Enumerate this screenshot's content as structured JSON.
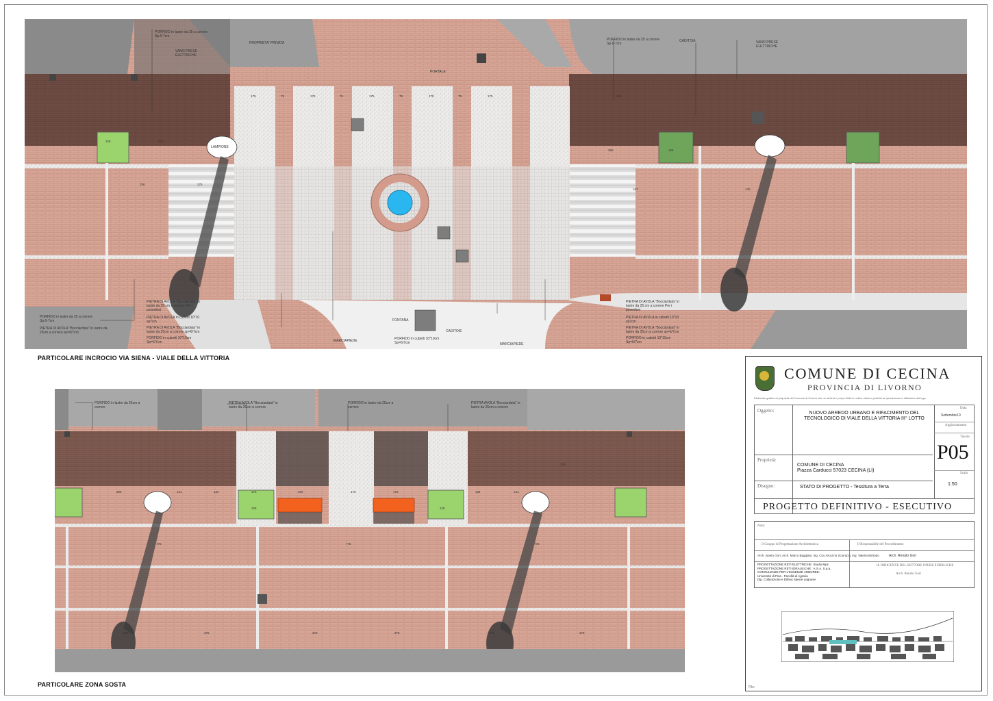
{
  "plans": {
    "top": {
      "title": "PARTICOLARE INCROCIO VIA SIENA - VIALE  DELLA VITTORIA",
      "labels": {
        "proprieta_privata": "PROPRIETA' PRIVATA",
        "portale": "PORTALE",
        "caditoia_top": "CADITOIA",
        "vano_prese_left": "VANO PRESE ELETTRICHE",
        "vano_prese_right": "VANO PRESE ELETTRICHE",
        "porfido_top_left": "PORFIDO in lastre da 25 a correre Sp.6-7cm",
        "porfido_top_right": "PORFIDO in lastre da 25 a correre Sp.6-7cm",
        "lampione": "LAMPIONE",
        "fontana": "FONTANA",
        "caditoie": "CADITOIE",
        "caditoie_left": "CADITOIE",
        "marciapiede_left": "MARCIAPIEDE",
        "marciapiede_right": "MARCIAPIEDE",
        "porfido_bottom_left": "PORFIDO in lastre da 25 a correre Sp.6-7cm",
        "pietra_bocciardata_left": "PIETRA DI AVOLA \"Bocciardata\" in lastre da 25cm a correre sp=6/7cm",
        "pietra_left_a": "PIETRA DI AVOLA \"Bocciardata\" in lastre da 25 cm a correre Per i povedieni",
        "pietra_left_b": "PIETRA DI AVOLA in cubetti 10*10 sp7cm",
        "pietra_left_c": "PIETRA DI AVOLA \"Bocciardata\" in lastre da 25cm a correre sp=6/7cm",
        "porfido_left_d": "PORFIDO in cubetti 10*10cm Sp=6/7cm",
        "porfido_center": "PORFIDO in cubetti 10*10cm Sp=6/7cm",
        "pietra_right_a": "PIETRA DI AVOLA \"Bocciardata\" in lastre da 25 cm a correre Per i povedieni",
        "pietra_right_b": "PIETRA DI AVOLA in cubetti 10*10 sp7cm",
        "pietra_right_c": "PIETRA DI AVOLA \"Bocciardata\" in lastre da 25cm a correre sp=6/7cm",
        "porfido_right_d": "PORFIDO in cubetti 10*10cm Sp=6/7cm"
      },
      "dims": [
        "175",
        "75",
        "175",
        "75",
        "175",
        "75",
        "175",
        "75",
        "175",
        "440",
        "125",
        "125",
        "25",
        "25",
        "336",
        "275",
        "360",
        "167",
        "175",
        "445"
      ]
    },
    "bottom": {
      "title": "PARTICOLARE  ZONA SOSTA",
      "labels": {
        "porfido_a": "PORFIDO in lastre da 25cm a correre",
        "pietra_a": "PIETRA AVOLA \"Bocciardata\" in lastre da 25cm a correre",
        "porfido_b": "PORFIDO in lastre da 25cm a correre",
        "pietra_b": "PIETRA AVOLA \"Bocciardata\" in lastre da 25cm a correre"
      },
      "dims": [
        "300",
        "141",
        "134",
        "175",
        "125",
        "200",
        "175",
        "175",
        "125",
        "134",
        "141",
        "125",
        "775",
        "775",
        "775",
        "375",
        "375",
        "375",
        "375",
        "375",
        "375",
        "25",
        "25",
        "25"
      ]
    }
  },
  "title_block": {
    "municipality": "COMUNE DI CECINA",
    "province": "PROVINCIA DI LIVORNO",
    "disclaimer": "Elaborato grafico di proprietà del Comune di Cecina che ne detiene i propri diritti in ordine citato e proibita la riproduzione e diffusione del logo",
    "oggetto_label": "Oggetto:",
    "oggetto_value": "NUOVO  ARREDO URBANO E RIFACIMENTO  DEL TECNOLOGICO DI VIALE DELLA VITTORIA III° LOTTO",
    "data_label": "Data",
    "data_value": "Settembre10",
    "aggiornamento_label": "Aggiornamento",
    "tavola_label": "Tavola",
    "tavola_value": "P05",
    "proprieta_label": "Proprietà:",
    "proprieta_value_1": "COMUNE DI CECINA",
    "proprieta_value_2": "Piazza Carducci  57023 CECINA (LI)",
    "scala_label": "Scala",
    "scala_value": "1:50",
    "disegno_label": "Disegno:",
    "disegno_value": "STATO DI PROGETTO - Tessitura a Terra",
    "fase": "PROGETTO  DEFINITIVO  -  ESECUTIVO",
    "note_label": "Note:",
    "gruppo_label": "Il Gruppo di Progettazione Architettonica",
    "gruppo_value": "Arch. Isanto Gori, Arch. Marco Bagglani, Ing. Ciro Alcozzio Sciuracci, Ing. Valeria Bertodo",
    "responsabile_label": "Il Responsabile del Procedimento",
    "responsabile_value": "Arch. Renato Gori",
    "consulenze": [
      "PROGETTAZIONE RETI ELETTRICHE: Studio Mps",
      "PROGETTAZIONE RETI IDRAULICHE : A.S.A. S.p.a.",
      "CONSULENZE PER L'ESSENZE ARBOREE:",
      "Università di Pisa - Facoltà di Agraria",
      "Dip. Coltivazione e Difesa Specie Legnose"
    ],
    "dirigente_label": "IL DIRIGENTE DEL SETTORE OPERE PUBBLICHE",
    "dirigente_value": "Arch. Renato Gori",
    "file_label": "File:"
  },
  "colors": {
    "brick": "#d6a394",
    "brick_dark": "#6b4a42",
    "gravel": "#e9e6e4",
    "grey": "#8b8b8b",
    "shadow": "#5d5d5d",
    "grass": "#9bd36d",
    "water": "#2ab6ef",
    "bench": "#f2621e"
  }
}
